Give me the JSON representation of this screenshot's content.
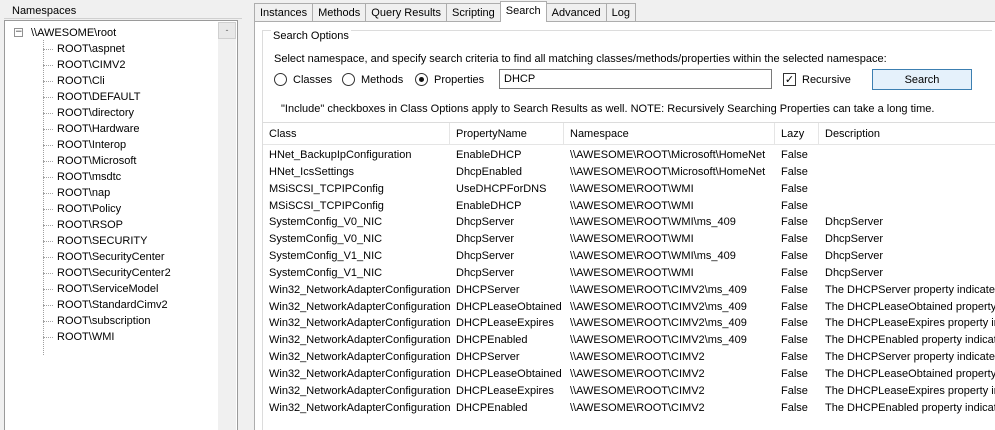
{
  "namespaces_panel": {
    "title": "Namespaces",
    "root": "\\\\AWESOME\\root",
    "toggle": "−",
    "scroll_button": "-",
    "items": [
      "ROOT\\aspnet",
      "ROOT\\CIMV2",
      "ROOT\\Cli",
      "ROOT\\DEFAULT",
      "ROOT\\directory",
      "ROOT\\Hardware",
      "ROOT\\Interop",
      "ROOT\\Microsoft",
      "ROOT\\msdtc",
      "ROOT\\nap",
      "ROOT\\Policy",
      "ROOT\\RSOP",
      "ROOT\\SECURITY",
      "ROOT\\SecurityCenter",
      "ROOT\\SecurityCenter2",
      "ROOT\\ServiceModel",
      "ROOT\\StandardCimv2",
      "ROOT\\subscription",
      "ROOT\\WMI"
    ]
  },
  "tabs": [
    "Instances",
    "Methods",
    "Query Results",
    "Scripting",
    "Search",
    "Advanced",
    "Log"
  ],
  "active_tab": "Search",
  "search_options": {
    "title": "Search Options",
    "instructions": "Select namespace, and specify search criteria to find all matching classes/methods/properties within the selected namespace:",
    "radio_classes": "Classes",
    "radio_methods": "Methods",
    "radio_properties": "Properties",
    "selected": "Properties",
    "query": "DHCP",
    "recursive_label": "Recursive",
    "recursive_checked": "✓",
    "search_button": "Search",
    "note": "\"Include\" checkboxes in Class Options apply to Search Results as well. NOTE: Recursively Searching Properties can take a long time."
  },
  "results": {
    "columns": [
      "Class",
      "PropertyName",
      "Namespace",
      "Lazy",
      "Description"
    ],
    "rows": [
      [
        "HNet_BackupIpConfiguration",
        "EnableDHCP",
        "\\\\AWESOME\\ROOT\\Microsoft\\HomeNet",
        "False",
        ""
      ],
      [
        "HNet_IcsSettings",
        "DhcpEnabled",
        "\\\\AWESOME\\ROOT\\Microsoft\\HomeNet",
        "False",
        ""
      ],
      [
        "MSiSCSI_TCPIPConfig",
        "UseDHCPForDNS",
        "\\\\AWESOME\\ROOT\\WMI",
        "False",
        ""
      ],
      [
        "MSiSCSI_TCPIPConfig",
        "EnableDHCP",
        "\\\\AWESOME\\ROOT\\WMI",
        "False",
        ""
      ],
      [
        "SystemConfig_V0_NIC",
        "DhcpServer",
        "\\\\AWESOME\\ROOT\\WMI\\ms_409",
        "False",
        "DhcpServer"
      ],
      [
        "SystemConfig_V0_NIC",
        "DhcpServer",
        "\\\\AWESOME\\ROOT\\WMI",
        "False",
        "DhcpServer"
      ],
      [
        "SystemConfig_V1_NIC",
        "DhcpServer",
        "\\\\AWESOME\\ROOT\\WMI\\ms_409",
        "False",
        "DhcpServer"
      ],
      [
        "SystemConfig_V1_NIC",
        "DhcpServer",
        "\\\\AWESOME\\ROOT\\WMI",
        "False",
        "DhcpServer"
      ],
      [
        "Win32_NetworkAdapterConfiguration",
        "DHCPServer",
        "\\\\AWESOME\\ROOT\\CIMV2\\ms_409",
        "False",
        "The DHCPServer property indicates"
      ],
      [
        "Win32_NetworkAdapterConfiguration",
        "DHCPLeaseObtained",
        "\\\\AWESOME\\ROOT\\CIMV2\\ms_409",
        "False",
        "The DHCPLeaseObtained property i"
      ],
      [
        "Win32_NetworkAdapterConfiguration",
        "DHCPLeaseExpires",
        "\\\\AWESOME\\ROOT\\CIMV2\\ms_409",
        "False",
        "The DHCPLeaseExpires property indica"
      ],
      [
        "Win32_NetworkAdapterConfiguration",
        "DHCPEnabled",
        "\\\\AWESOME\\ROOT\\CIMV2\\ms_409",
        "False",
        "The DHCPEnabled property indicate"
      ],
      [
        "Win32_NetworkAdapterConfiguration",
        "DHCPServer",
        "\\\\AWESOME\\ROOT\\CIMV2",
        "False",
        "The DHCPServer property indicates"
      ],
      [
        "Win32_NetworkAdapterConfiguration",
        "DHCPLeaseObtained",
        "\\\\AWESOME\\ROOT\\CIMV2",
        "False",
        "The DHCPLeaseObtained property i"
      ],
      [
        "Win32_NetworkAdapterConfiguration",
        "DHCPLeaseExpires",
        "\\\\AWESOME\\ROOT\\CIMV2",
        "False",
        "The DHCPLeaseExpires property indica"
      ],
      [
        "Win32_NetworkAdapterConfiguration",
        "DHCPEnabled",
        "\\\\AWESOME\\ROOT\\CIMV2",
        "False",
        "The DHCPEnabled property indicate"
      ]
    ]
  }
}
